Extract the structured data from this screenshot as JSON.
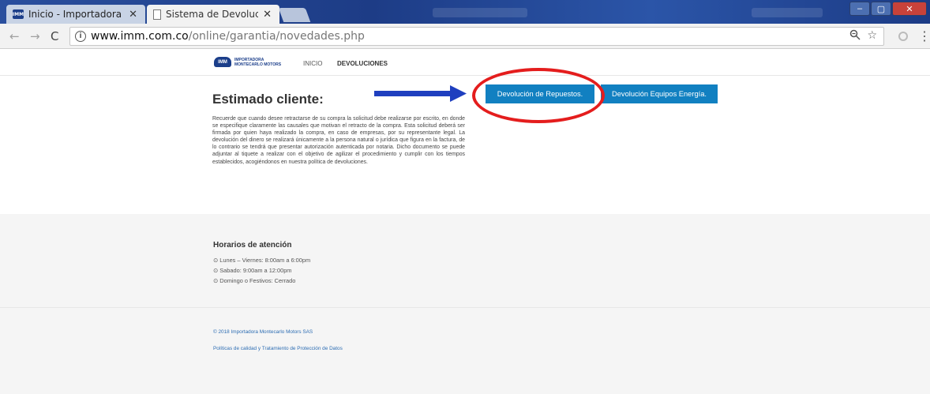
{
  "browser": {
    "tabs": [
      {
        "title": "Inicio - Importadora Mon",
        "favicon": "imm-logo-icon",
        "active": false
      },
      {
        "title": "Sistema de Devoluciones",
        "favicon": "document-icon",
        "active": true
      }
    ],
    "tab_close_glyph": "✕",
    "url_host": "www.imm.com.co",
    "url_path": "/online/garantia/novedades.php",
    "window_buttons": {
      "minimize": "‒",
      "maximize": "▢",
      "close": "✕"
    }
  },
  "site": {
    "logo_mark": "IMM",
    "logo_text_top": "IMPORTADORA",
    "logo_text_bottom": "MONTECARLO MOTORS",
    "nav": {
      "inicio": "INICIO",
      "devoluciones": "DEVOLUCIONES"
    }
  },
  "main": {
    "title": "Estimado cliente:",
    "body": "Recuerde que cuando desee retractarse de su compra la solicitud debe realizarse por escrito, en donde se especifique claramente las causales que motivan el retracto de la compra. Esta solicitud deberá ser firmada por quien haya realizado la compra, en caso de empresas, por su representante legal. La devolución del dinero se realizará únicamente a la persona natural o jurídica que figura en la factura, de lo contrario se tendrá que presentar autorización autenticada por notaria. Dicho documento se puede adjuntar al tiquete a realizar con el objetivo de agilizar el procedimiento y cumplir con los tiempos establecidos, acogiéndonos en nuestra política de devoluciones.",
    "btn_repuestos": "Devolución de Repuestos.",
    "btn_energia": "Devolución Equipos Energía."
  },
  "hours": {
    "title": "Horarios de atención",
    "lines": [
      "⊙ Lunes – Viernes: 8:00am a 6:00pm",
      "⊙ Sabado: 9:00am a 12:00pm",
      "⊙ Domingo o Festivos: Cerrado"
    ]
  },
  "footer": {
    "copyright": "© 2018 Importadora Montecarlo Motors SAS",
    "policy": "Políticas de calidad y Tratamiento de Protección de Datos"
  },
  "colors": {
    "accent_button": "#1180c1",
    "annotation_red": "#e41d1d",
    "annotation_arrow": "#1f3fbf"
  }
}
